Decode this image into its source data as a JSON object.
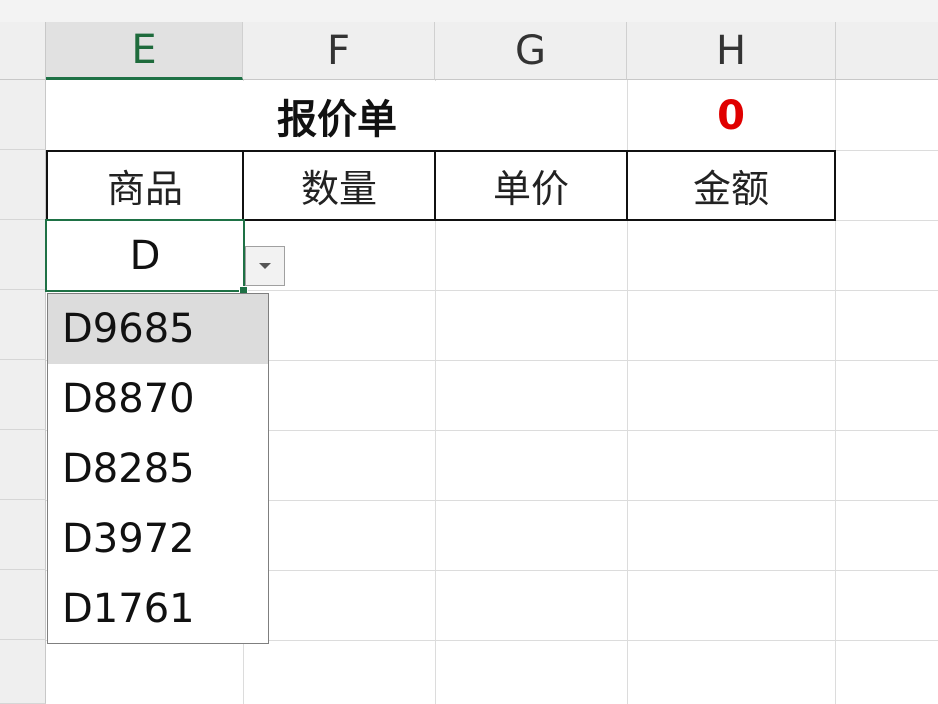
{
  "columns": [
    {
      "letter": "E",
      "selected": true
    },
    {
      "letter": "F",
      "selected": false
    },
    {
      "letter": "G",
      "selected": false
    },
    {
      "letter": "H",
      "selected": false
    }
  ],
  "sheet": {
    "title": "报价单",
    "total": "0",
    "headers": [
      "商品",
      "数量",
      "单价",
      "金额"
    ],
    "active_cell_value": "D"
  },
  "dropdown": {
    "options": [
      "D9685",
      "D8870",
      "D8285",
      "D3972",
      "D1761"
    ],
    "highlighted_index": 0
  },
  "colors": {
    "accent": "#1e7145",
    "total_text": "#e00000",
    "highlight": "#dcdcdc"
  },
  "icons": {
    "dropdown_arrow": "chevron-down-icon"
  }
}
